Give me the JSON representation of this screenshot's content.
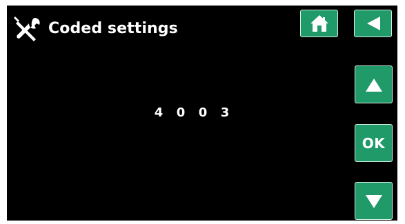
{
  "header": {
    "title": "Coded settings",
    "icon": "tools-icon"
  },
  "buttons": {
    "home": {
      "icon": "home-icon"
    },
    "back": {
      "icon": "back-arrow-icon"
    },
    "up": {
      "icon": "up-arrow-icon"
    },
    "ok": {
      "label": "OK"
    },
    "down": {
      "icon": "down-arrow-icon"
    }
  },
  "code": {
    "digits": [
      "4",
      "0",
      "0",
      "3"
    ]
  },
  "colors": {
    "background": "#000000",
    "button_fill": "#1f9a68",
    "button_border": "#d9f0e6",
    "text": "#ffffff"
  }
}
